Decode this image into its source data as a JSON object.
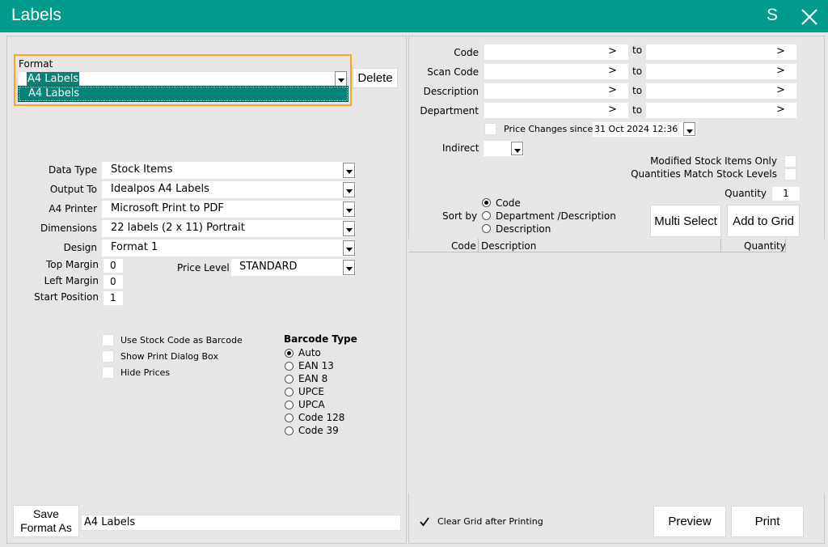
{
  "window": {
    "title": "Labels",
    "s_label": "S"
  },
  "format": {
    "label": "Format",
    "selected": "A4 Labels",
    "option": "A4 Labels",
    "delete_label": "Delete"
  },
  "left_fields": {
    "data_type": {
      "label": "Data Type",
      "value": "Stock Items"
    },
    "output_to": {
      "label": "Output To",
      "value": "Idealpos A4 Labels"
    },
    "a4_printer": {
      "label": "A4 Printer",
      "value": "Microsoft Print to PDF"
    },
    "dimensions": {
      "label": "Dimensions",
      "value": "22 labels (2 x 11) Portrait"
    },
    "design": {
      "label": "Design",
      "value": "Format 1"
    },
    "top_margin": {
      "label": "Top Margin",
      "value": "0"
    },
    "left_margin": {
      "label": "Left Margin",
      "value": "0"
    },
    "start_position": {
      "label": "Start Position",
      "value": "1"
    },
    "price_level": {
      "label": "Price Level",
      "value": "STANDARD"
    }
  },
  "options": {
    "use_stock_code": "Use Stock Code as Barcode",
    "show_print_dialog": "Show Print Dialog Box",
    "hide_prices": "Hide Prices"
  },
  "barcode": {
    "title": "Barcode Type",
    "types": [
      "Auto",
      "EAN 13",
      "EAN 8",
      "UPCE",
      "UPCA",
      "Code 128",
      "Code 39"
    ],
    "selected": "Auto"
  },
  "save_format": {
    "button": "Save Format As",
    "value": "A4 Labels"
  },
  "filters": {
    "code": "Code",
    "scan_code": "Scan Code",
    "description": "Description",
    "department": "Department",
    "to": "to",
    "arrow": ">",
    "price_changes_since": "Price Changes since",
    "price_date": "31 Oct  2024 12:36",
    "indirect": "Indirect",
    "modified_only": "Modified Stock Items Only",
    "qty_match": "Quantities Match Stock Levels",
    "quantity_label": "Quantity",
    "quantity_value": "1"
  },
  "sort": {
    "label": "Sort by",
    "options": [
      "Code",
      "Department /Description",
      "Description"
    ],
    "selected": "Code"
  },
  "grid": {
    "multi_select": "Multi Select",
    "add_to_grid": "Add to Grid",
    "columns": [
      "Code",
      "Description",
      "Quantity"
    ]
  },
  "footer": {
    "clear_grid": "Clear Grid after Printing",
    "preview": "Preview",
    "print": "Print"
  }
}
